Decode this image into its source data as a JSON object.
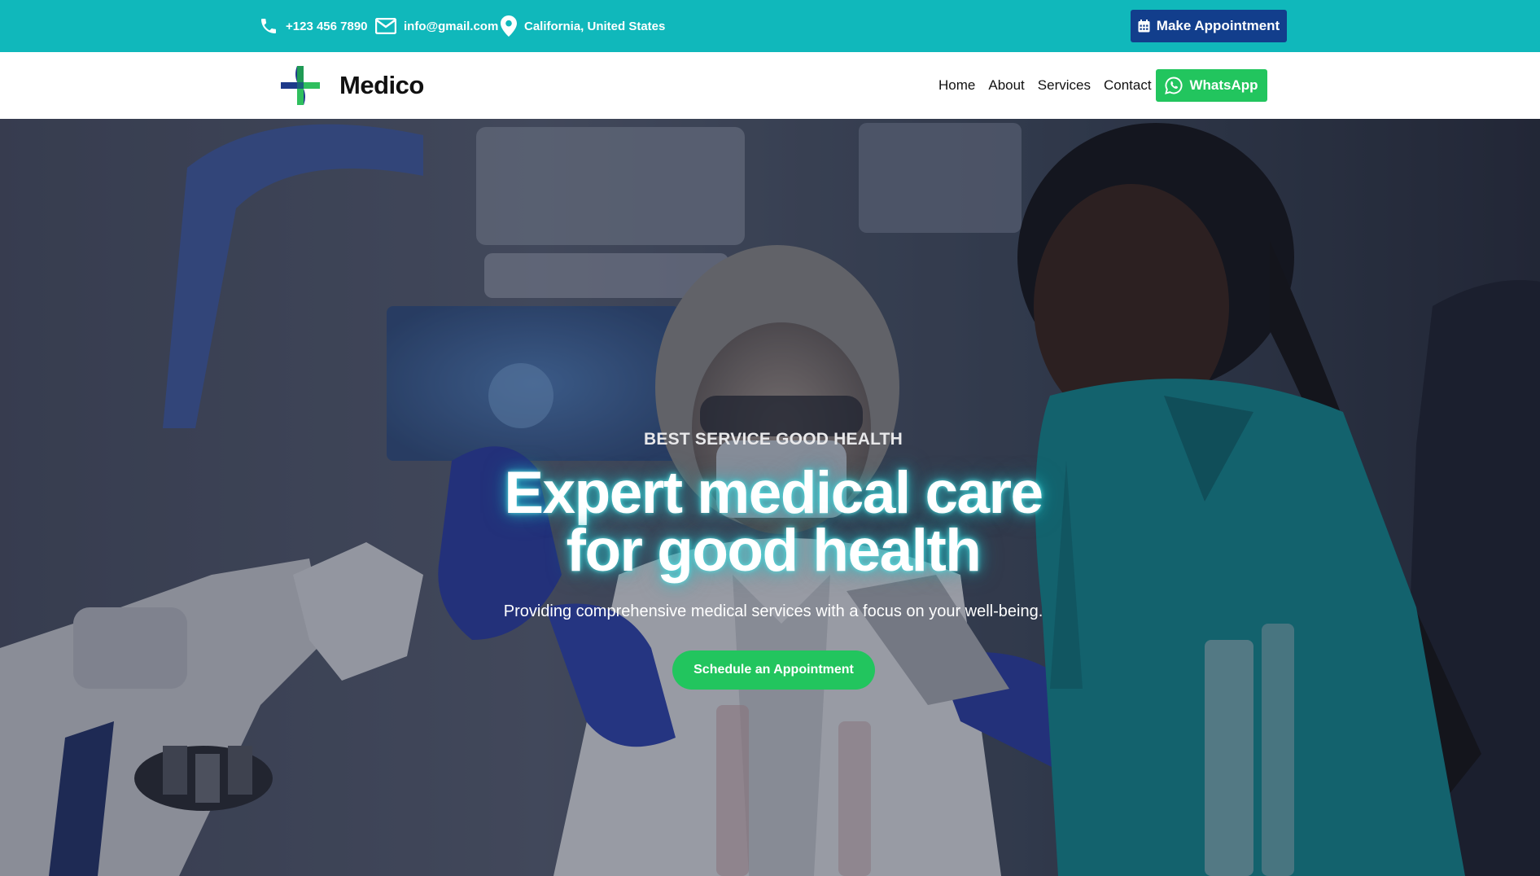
{
  "topbar": {
    "phone": "+123 456 7890",
    "email": "info@gmail.com",
    "location": "California, United States",
    "appointment_label": "Make Appointment",
    "bg_color": "#10b8bb",
    "button_color": "#123e8c"
  },
  "header": {
    "brand": "Medico",
    "nav": [
      "Home",
      "About",
      "Services",
      "Contact"
    ],
    "whatsapp_label": "WhatsApp",
    "whatsapp_color": "#22c55e"
  },
  "hero": {
    "eyebrow": "BEST SERVICE GOOD HEALTH",
    "headline_line1": "Expert medical care",
    "headline_line2": "for good health",
    "subtext": "Providing comprehensive medical services with a focus on your well-being.",
    "cta_label": "Schedule an Appointment",
    "cta_color": "#22c55e"
  },
  "icons": {
    "phone": "phone-icon",
    "email": "envelope-icon",
    "location": "map-pin-icon",
    "calendar": "calendar-icon",
    "whatsapp": "whatsapp-icon",
    "logo": "medical-cross-icon"
  }
}
